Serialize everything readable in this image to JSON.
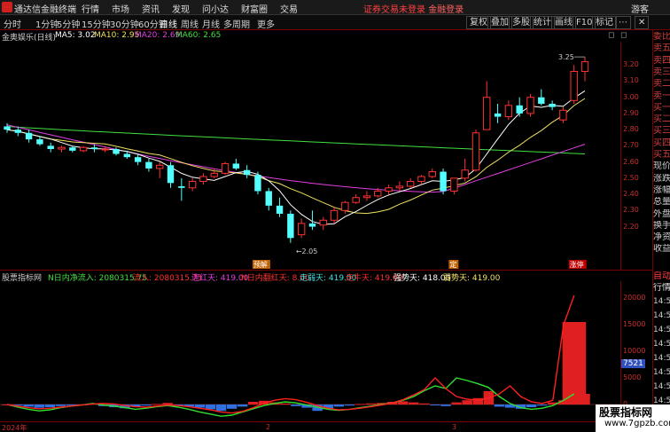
{
  "app": {
    "name": "通达信金融终端",
    "menus": [
      "行情",
      "市场",
      "资讯",
      "发现",
      "问小达",
      "财富圈",
      "交易"
    ],
    "login_notice": "证券交易未登录",
    "login_action": "金融登录",
    "guest": "游客"
  },
  "toolbar": {
    "periods": [
      "分时",
      "1分钟",
      "5分钟",
      "15分钟",
      "30分钟",
      "60分钟",
      "日线",
      "周线",
      "月线",
      "多周期",
      "更多"
    ],
    "active_period": "日线",
    "right_buttons": [
      "复权",
      "叠加",
      "多股",
      "统计",
      "画线",
      "F10",
      "标记"
    ]
  },
  "main_chart": {
    "title": "金奥娱乐(日线)",
    "ma": [
      {
        "label": "MA5: 3.02",
        "color": "#ffffff"
      },
      {
        "label": "MA10: 2.95",
        "color": "#f0e060"
      },
      {
        "label": "MA20: 2.69",
        "color": "#e040e0"
      },
      {
        "label": "MA60: 2.65",
        "color": "#40e040"
      }
    ],
    "price_ticks": [
      "3.20",
      "3.10",
      "3.00",
      "2.90",
      "2.80",
      "2.70",
      "2.60",
      "2.50",
      "2.40",
      "2.30",
      "2.20"
    ],
    "high_annotation": "3.25",
    "low_annotation": "2.05",
    "events": [
      {
        "label": "预解",
        "color": "#c06000"
      },
      {
        "label": "定",
        "color": "#c06000"
      },
      {
        "label": "涨停",
        "color": "#c00000"
      }
    ]
  },
  "sub_chart": {
    "title": "股票指标网",
    "items": [
      {
        "label": "N日内净流入: 2080315.75",
        "color": "#40e040"
      },
      {
        "label": "流入: 2080315.75",
        "color": "#ff3030"
      },
      {
        "label": "连红天: 419.00",
        "color": "#e040e0"
      },
      {
        "label": "N日内翻红天: 8.00",
        "color": "#ff3030"
      },
      {
        "label": "走弱天: 419.00",
        "color": "#40e0e0"
      },
      {
        "label": "走牛天: 419.00",
        "color": "#ff3030"
      },
      {
        "label": "强势天: 418.00",
        "color": "#ffffff"
      },
      {
        "label": "弱势天: 419.00",
        "color": "#f0e060"
      }
    ],
    "ticks": [
      "20000",
      "15000",
      "10000",
      "5000",
      "0"
    ],
    "current_value": "7521"
  },
  "x_axis": {
    "labels": [
      "2024年",
      "2",
      "3"
    ]
  },
  "right_panel": {
    "quote_labels": [
      "委比",
      "卖五",
      "卖四",
      "卖三",
      "卖二",
      "卖一",
      "买一",
      "买二",
      "买三",
      "买四",
      "买五",
      "现价",
      "涨跌",
      "涨幅",
      "总量",
      "外盘",
      "换手",
      "净资",
      "收益"
    ],
    "tick_header": [
      "自动",
      "行情"
    ],
    "tick_times": [
      "14:50",
      "14:50",
      "14:50",
      "14:50",
      "14:50",
      "14:50",
      "14:50",
      "14:50",
      "14:50"
    ]
  },
  "watermark": {
    "line1": "股票指标网",
    "line2": "www.7gpzb.com"
  },
  "chart_data": {
    "type": "candlestick",
    "price_range": [
      2.0,
      3.3
    ],
    "candles": [
      [
        2.82,
        2.84,
        2.78,
        2.8
      ],
      [
        2.8,
        2.82,
        2.76,
        2.78
      ],
      [
        2.78,
        2.8,
        2.72,
        2.74
      ],
      [
        2.74,
        2.76,
        2.7,
        2.71
      ],
      [
        2.7,
        2.72,
        2.66,
        2.68
      ],
      [
        2.68,
        2.7,
        2.66,
        2.69
      ],
      [
        2.69,
        2.7,
        2.66,
        2.67
      ],
      [
        2.67,
        2.7,
        2.66,
        2.69
      ],
      [
        2.69,
        2.71,
        2.66,
        2.68
      ],
      [
        2.68,
        2.7,
        2.66,
        2.68
      ],
      [
        2.68,
        2.69,
        2.64,
        2.65
      ],
      [
        2.65,
        2.67,
        2.62,
        2.63
      ],
      [
        2.63,
        2.65,
        2.58,
        2.6
      ],
      [
        2.6,
        2.62,
        2.54,
        2.56
      ],
      [
        2.56,
        2.6,
        2.5,
        2.58
      ],
      [
        2.58,
        2.6,
        2.44,
        2.47
      ],
      [
        2.45,
        2.5,
        2.36,
        2.44
      ],
      [
        2.44,
        2.5,
        2.42,
        2.48
      ],
      [
        2.48,
        2.53,
        2.46,
        2.51
      ],
      [
        2.51,
        2.56,
        2.5,
        2.53
      ],
      [
        2.53,
        2.6,
        2.52,
        2.59
      ],
      [
        2.59,
        2.62,
        2.55,
        2.56
      ],
      [
        2.55,
        2.58,
        2.5,
        2.52
      ],
      [
        2.52,
        2.54,
        2.4,
        2.42
      ],
      [
        2.42,
        2.44,
        2.3,
        2.33
      ],
      [
        2.33,
        2.38,
        2.26,
        2.28
      ],
      [
        2.28,
        2.3,
        2.1,
        2.13
      ],
      [
        2.15,
        2.25,
        2.13,
        2.22
      ],
      [
        2.22,
        2.3,
        2.18,
        2.2
      ],
      [
        2.21,
        2.26,
        2.18,
        2.24
      ],
      [
        2.24,
        2.32,
        2.22,
        2.3
      ],
      [
        2.3,
        2.36,
        2.28,
        2.35
      ],
      [
        2.35,
        2.4,
        2.34,
        2.38
      ],
      [
        2.38,
        2.42,
        2.36,
        2.39
      ],
      [
        2.39,
        2.44,
        2.38,
        2.42
      ],
      [
        2.42,
        2.46,
        2.4,
        2.44
      ],
      [
        2.44,
        2.48,
        2.42,
        2.45
      ],
      [
        2.45,
        2.5,
        2.44,
        2.48
      ],
      [
        2.48,
        2.52,
        2.46,
        2.51
      ],
      [
        2.51,
        2.56,
        2.5,
        2.54
      ],
      [
        2.54,
        2.56,
        2.4,
        2.42
      ],
      [
        2.42,
        2.5,
        2.4,
        2.5
      ],
      [
        2.5,
        2.62,
        2.48,
        2.55
      ],
      [
        2.55,
        2.8,
        2.54,
        2.78
      ],
      [
        2.8,
        3.1,
        2.9,
        3.0
      ],
      [
        2.9,
        2.96,
        2.84,
        2.88
      ],
      [
        2.88,
        2.98,
        2.86,
        2.95
      ],
      [
        2.95,
        3.0,
        2.88,
        2.9
      ],
      [
        2.9,
        3.02,
        2.88,
        3.0
      ],
      [
        3.0,
        3.05,
        2.95,
        2.96
      ],
      [
        2.96,
        2.98,
        2.92,
        2.94
      ],
      [
        2.86,
        2.94,
        2.84,
        2.92
      ],
      [
        2.98,
        3.2,
        2.96,
        3.16
      ],
      [
        3.16,
        3.25,
        3.1,
        3.22
      ]
    ],
    "sub_series": {
      "bars": [
        0,
        -200,
        -400,
        -600,
        -500,
        -300,
        -200,
        -100,
        200,
        -300,
        -500,
        -700,
        -400,
        -200,
        100,
        300,
        -200,
        -400,
        -600,
        -900,
        -1200,
        -800,
        -400,
        500,
        700,
        400,
        200,
        -300,
        -600,
        -1200,
        -900,
        -400,
        -200,
        100,
        200,
        300,
        500,
        600,
        400,
        200,
        -100,
        -300,
        400,
        800,
        1200,
        2500,
        -400,
        -600,
        -800,
        -500,
        -200,
        400,
        800,
        15500,
        2000
      ],
      "green": [
        0,
        -500,
        -900,
        -1200,
        -1000,
        -600,
        -300,
        -100,
        200,
        -100,
        -300,
        -600,
        -900,
        -700,
        -400,
        -200,
        -500,
        -900,
        -1400,
        -1800,
        -2200,
        -2000,
        -1400,
        -800,
        -200,
        200,
        500,
        300,
        -100,
        -500,
        -900,
        -1100,
        -900,
        -600,
        -300,
        0,
        300,
        800,
        1500,
        2600,
        3500,
        3000,
        5000,
        4500,
        3900,
        3200,
        1500,
        200,
        -600,
        -900,
        -700,
        -200,
        800,
        2000
      ],
      "red": [
        0,
        -300,
        -600,
        -800,
        -700,
        -500,
        -300,
        -100,
        100,
        200,
        100,
        -200,
        -400,
        -500,
        -300,
        -100,
        -200,
        -400,
        -700,
        -1000,
        -1400,
        -1600,
        -1300,
        -600,
        200,
        800,
        1100,
        900,
        400,
        -200,
        -700,
        -1000,
        -900,
        -700,
        -400,
        -100,
        300,
        900,
        1800,
        2800,
        5000,
        3000,
        1500,
        1000,
        800,
        1200,
        2000,
        3500,
        1500,
        500,
        200,
        800,
        15000,
        20500
      ]
    }
  }
}
